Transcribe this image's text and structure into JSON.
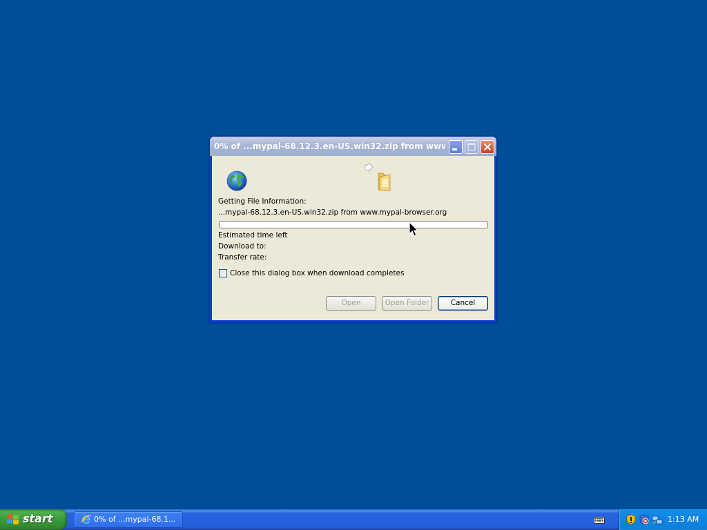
{
  "desktop": {
    "background_color": "#004E98"
  },
  "dialog": {
    "title": "0% of ...mypal-68.12.3.en-US.win32.zip from www...",
    "status_label": "Getting File Information:",
    "file_line": "...mypal-68.12.3.en-US.win32.zip from www.mypal-browser.org",
    "progress_percent": 0,
    "estimated_time_label": "Estimated time left",
    "download_to_label": "Download to:",
    "transfer_rate_label": "Transfer rate:",
    "close_checkbox_label": "Close this dialog box when download completes",
    "close_checkbox_checked": false,
    "buttons": {
      "open": "Open",
      "open_folder": "Open Folder",
      "cancel": "Cancel"
    },
    "icons": {
      "globe": "globe-icon",
      "folder": "folder-icon",
      "paper": "flying-paper-icon"
    }
  },
  "taskbar": {
    "start_label": "start",
    "tasks": [
      {
        "label": "0% of ...mypal-68.1...",
        "icon": "internet-explorer-icon"
      }
    ],
    "tray": {
      "icons": [
        "keyboard-icon",
        "security-shield-icon",
        "security-alert-icon",
        "network-icon"
      ],
      "clock": "1:13 AM"
    }
  }
}
